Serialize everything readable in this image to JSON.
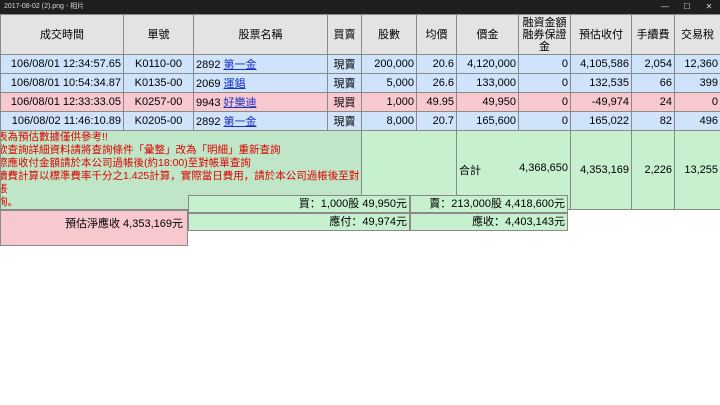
{
  "window": {
    "title": "2017-08-02 (2).png - 相片",
    "controls": [
      "—",
      "☐",
      "✕"
    ]
  },
  "headers": [
    "成交時間",
    "單號",
    "股票名稱",
    "買賣",
    "股數",
    "均價",
    "價金",
    "融資金額\n融券保證金",
    "預估收付",
    "手續費",
    "交易稅"
  ],
  "rows": [
    {
      "time": "106/08/01 12:34:57.65",
      "order": "K0110-00",
      "code": "2892",
      "name": "第一金",
      "side": "現賣",
      "shares": "200,000",
      "avg": "20.6",
      "amount": "4,120,000",
      "margin": "0",
      "settle": "4,105,586",
      "fee": "2,054",
      "tax": "12,360",
      "type": "sell"
    },
    {
      "time": "106/08/01 10:54:34.87",
      "order": "K0135-00",
      "code": "2069",
      "name": "運錩",
      "side": "現賣",
      "shares": "5,000",
      "avg": "26.6",
      "amount": "133,000",
      "margin": "0",
      "settle": "132,535",
      "fee": "66",
      "tax": "399",
      "type": "sell"
    },
    {
      "time": "106/08/01 12:33:33.05",
      "order": "K0257-00",
      "code": "9943",
      "name": "好樂迪",
      "side": "現買",
      "shares": "1,000",
      "avg": "49.95",
      "amount": "49,950",
      "margin": "0",
      "settle": "-49,974",
      "fee": "24",
      "tax": "0",
      "type": "buy"
    },
    {
      "time": "106/08/02 11:46:10.89",
      "order": "K0205-00",
      "code": "2892",
      "name": "第一金",
      "side": "現賣",
      "shares": "8,000",
      "avg": "20.7",
      "amount": "165,600",
      "margin": "0",
      "settle": "165,022",
      "fee": "82",
      "tax": "496",
      "type": "sell"
    }
  ],
  "notes": [
    "表為預估數據僅供參考!!",
    "欲查詢詳細資料請將查詢條件「彙整」改為「明細」重新查詢",
    "際應收付金額請於本公司過帳後(約18:00)至對帳單查詢",
    "續費計算以標準費率千分之1.425計算，實際當日費用，請於本公司過帳後至對帳",
    "詢。"
  ],
  "summary": {
    "label": "合計",
    "amount": "4,368,650",
    "settle": "4,353,169",
    "fee": "2,226",
    "tax": "13,255"
  },
  "bottom": {
    "net_receivable": "預估淨應收 4,353,169元",
    "buy_total": "買：1,000股 49,950元",
    "sell_total": "賣：213,000股 4,418,600元",
    "payable": "應付：49,974元",
    "receivable": "應收：4,403,143元"
  },
  "colors": {
    "buy_row": "#cfe3fb",
    "sell_row": "#f8c8cf",
    "summary_bg": "#c7f0cf",
    "note_text": "#e00000",
    "link": "#1a32c8"
  }
}
